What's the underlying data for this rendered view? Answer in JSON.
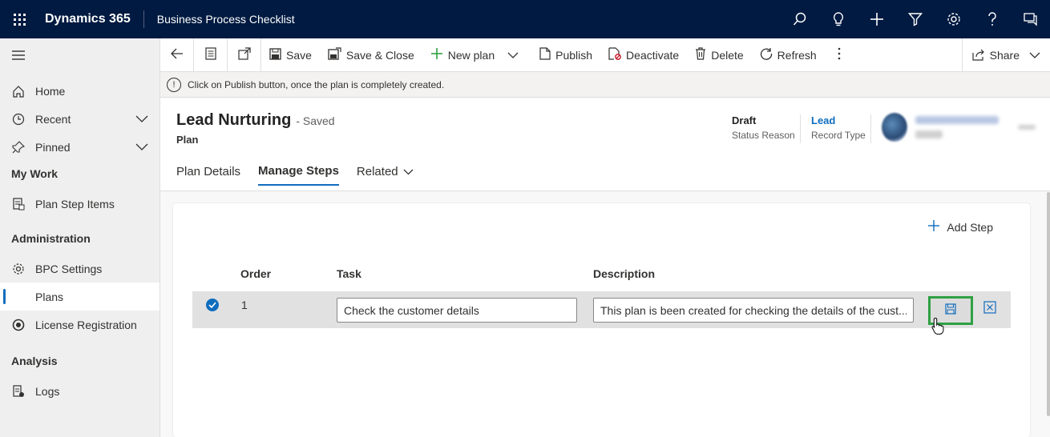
{
  "app": {
    "name": "Dynamics 365",
    "title": "Business Process Checklist"
  },
  "topbar_icons": [
    "search-icon",
    "lightbulb-icon",
    "plus-icon",
    "filter-icon",
    "gear-icon",
    "help-icon",
    "chat-icon"
  ],
  "sidebar": {
    "items": [
      {
        "label": "Home",
        "icon": "home-icon"
      },
      {
        "label": "Recent",
        "icon": "clock-icon"
      },
      {
        "label": "Pinned",
        "icon": "pin-icon"
      }
    ],
    "groups": [
      {
        "title": "My Work",
        "items": [
          {
            "label": "Plan Step Items",
            "icon": "document-icon"
          }
        ]
      },
      {
        "title": "Administration",
        "items": [
          {
            "label": "BPC Settings",
            "icon": "gear-icon"
          },
          {
            "label": "Plans",
            "icon": "plans-icon"
          },
          {
            "label": "License Registration",
            "icon": "license-icon"
          }
        ]
      },
      {
        "title": "Analysis",
        "items": [
          {
            "label": "Logs",
            "icon": "logs-icon"
          }
        ]
      }
    ]
  },
  "commands": {
    "save": "Save",
    "save_close": "Save & Close",
    "new_plan": "New plan",
    "publish": "Publish",
    "deactivate": "Deactivate",
    "delete": "Delete",
    "refresh": "Refresh",
    "share": "Share"
  },
  "notice": "Click on Publish button, once the plan is completely created.",
  "record": {
    "title": "Lead Nurturing",
    "saved": "- Saved",
    "entity": "Plan",
    "status_value": "Draft",
    "status_label": "Status Reason",
    "type_value": "Lead",
    "type_label": "Record Type"
  },
  "tabs": [
    {
      "label": "Plan Details"
    },
    {
      "label": "Manage Steps"
    },
    {
      "label": "Related"
    }
  ],
  "steps": {
    "add_label": "Add Step",
    "columns": {
      "order": "Order",
      "task": "Task",
      "description": "Description"
    },
    "rows": [
      {
        "order": "1",
        "task": "Check the customer details",
        "description": "This plan is been created for checking the details of the cust..."
      }
    ]
  },
  "colors": {
    "topbar": "#001a41",
    "accent": "#0f6cbd",
    "highlight": "#2ea043"
  }
}
